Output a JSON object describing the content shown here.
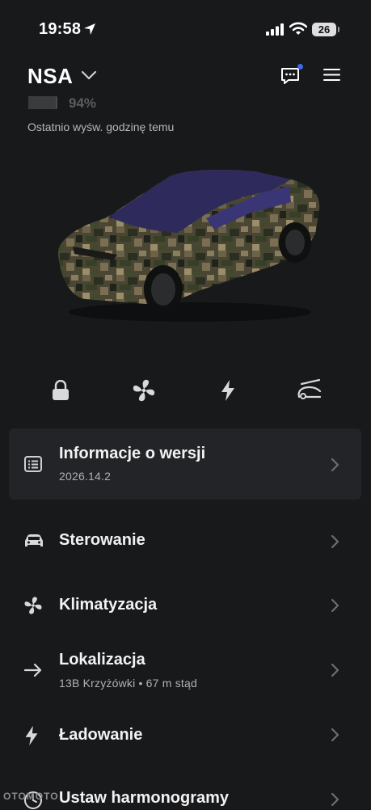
{
  "status_bar": {
    "time": "19:58",
    "battery": "26",
    "icons": [
      "location-arrow-icon",
      "signal-bars-icon",
      "wifi-icon",
      "battery-icon"
    ]
  },
  "header": {
    "car_name": "NSA",
    "battery_percent": "94%",
    "battery_level": 0.94,
    "last_seen": "Ostatnio wyśw. godzinę temu",
    "icons": [
      "chevron-down-icon",
      "message-icon",
      "menu-icon"
    ],
    "notification_color": "#3e6ae1"
  },
  "controls": [
    {
      "name": "lock",
      "icon": "lock-icon"
    },
    {
      "name": "fan",
      "icon": "fan-icon"
    },
    {
      "name": "charge",
      "icon": "lightning-icon"
    },
    {
      "name": "frunk",
      "icon": "frunk-icon"
    }
  ],
  "menu": {
    "version": {
      "title": "Informacje o wersji",
      "subtitle": "2026.14.2",
      "icon": "release-notes-icon"
    },
    "items": [
      {
        "title": "Sterowanie",
        "icon": "car-icon"
      },
      {
        "title": "Klimatyzacja",
        "icon": "fan-icon"
      },
      {
        "title": "Lokalizacja",
        "subtitle": "13B Krzyżówki • 67 m stąd",
        "icon": "arrow-right-icon"
      },
      {
        "title": "Ładowanie",
        "icon": "lightning-icon"
      },
      {
        "title": "Ustaw harmonogramy",
        "icon": "clock-icon"
      }
    ]
  },
  "watermark": "OTOMOTO",
  "colors": {
    "background": "#18191b",
    "card": "#232427",
    "accent": "#3e6ae1"
  }
}
